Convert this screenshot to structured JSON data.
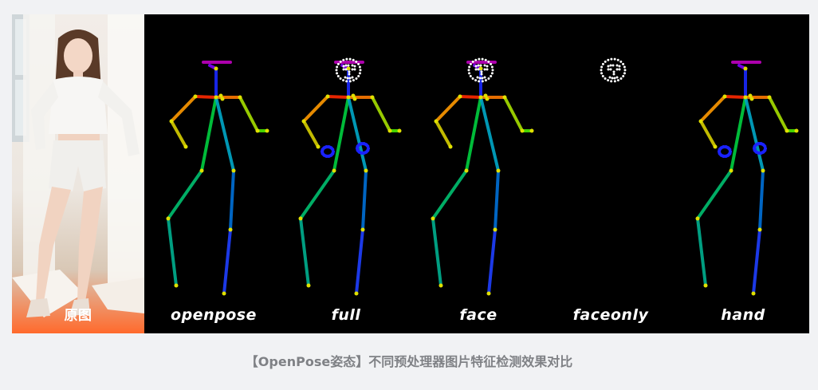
{
  "photo": {
    "label": "原图"
  },
  "panels": [
    {
      "label": "openpose"
    },
    {
      "label": "full"
    },
    {
      "label": "face"
    },
    {
      "label": "faceonly"
    },
    {
      "label": "hand"
    }
  ],
  "caption": "【OpenPose姿态】不同预处理器图片特征检测效果对比",
  "colors": {
    "frame_bg": "#000000",
    "page_bg": "#f1f2f4",
    "caption": "#7f8185",
    "face_points": "#ffffff",
    "hand_points": "#1a22ff"
  }
}
